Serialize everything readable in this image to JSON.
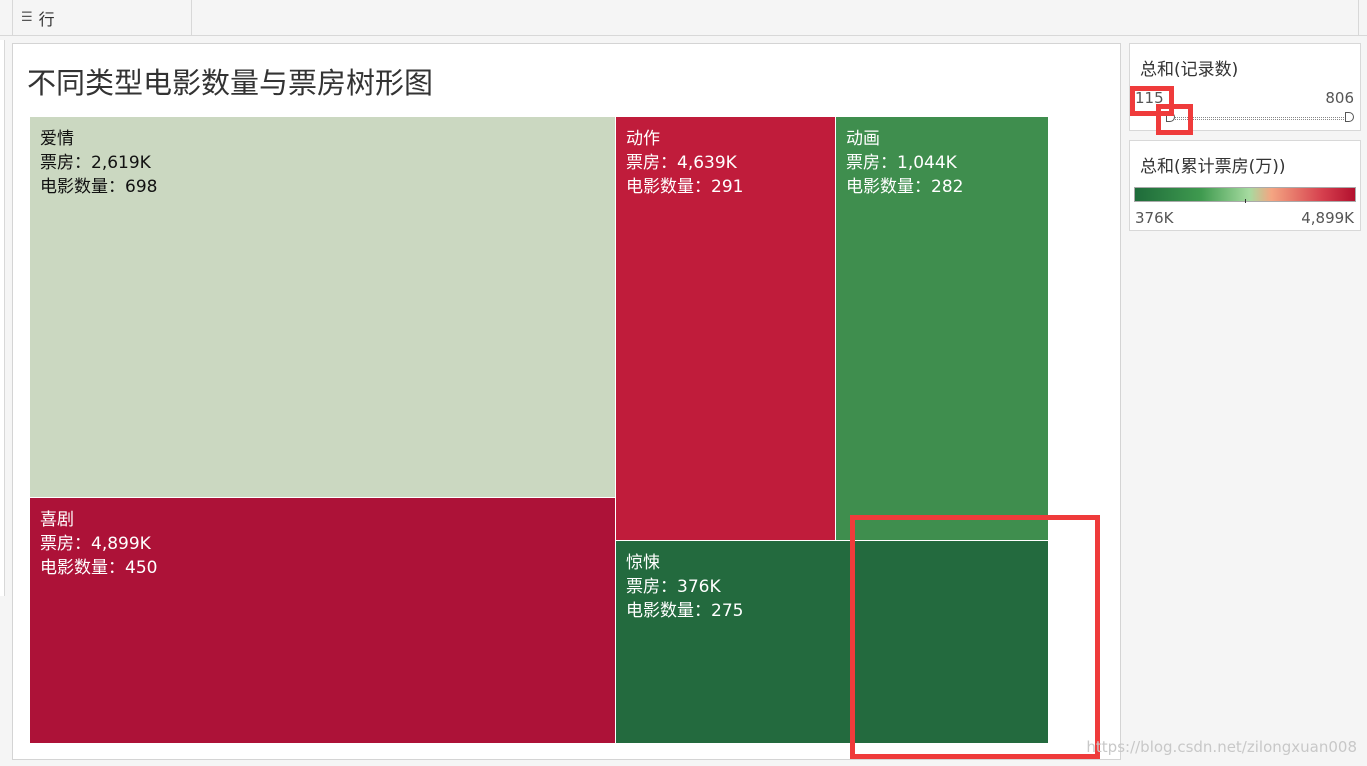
{
  "shelf": {
    "label": "行",
    "icon": "list-icon"
  },
  "chart_data": {
    "type": "treemap",
    "title": "不同类型电影数量与票房树形图",
    "value_label": "票房：",
    "count_label": "电影数量：",
    "cells": [
      {
        "name": "爱情",
        "box_office": "2,619K",
        "box_office_value": 2619,
        "count": 698,
        "count_text": "698",
        "color": "#cbd8c1",
        "text_color": "#111111"
      },
      {
        "name": "喜剧",
        "box_office": "4,899K",
        "box_office_value": 4899,
        "count": 450,
        "count_text": "450",
        "color": "#ad1238",
        "text_color": "#ffffff"
      },
      {
        "name": "动作",
        "box_office": "4,639K",
        "box_office_value": 4639,
        "count": 291,
        "count_text": "291",
        "color": "#c01c3b",
        "text_color": "#ffffff"
      },
      {
        "name": "动画",
        "box_office": "1,044K",
        "box_office_value": 1044,
        "count": 282,
        "count_text": "282",
        "color": "#3f8e4e",
        "text_color": "#ffffff"
      },
      {
        "name": "惊悚",
        "box_office": "376K",
        "box_office_value": 376,
        "count": 275,
        "count_text": "275",
        "color": "#236a3e",
        "text_color": "#ffffff"
      }
    ]
  },
  "size_legend": {
    "title": "总和(记录数)",
    "min": "115",
    "max": "806",
    "min_value": 115,
    "max_value": 806
  },
  "color_legend": {
    "title": "总和(累计票房(万))",
    "min": "376K",
    "max": "4,899K"
  },
  "watermark": "https://blog.csdn.net/zilongxuan008"
}
